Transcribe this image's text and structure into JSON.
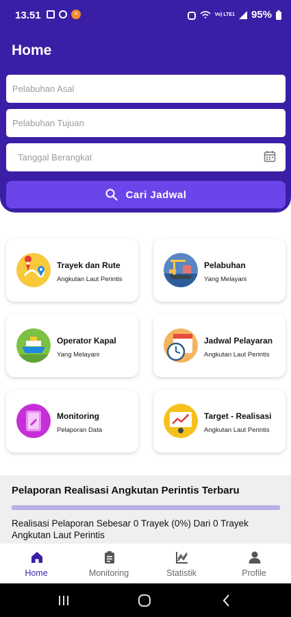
{
  "status_bar": {
    "time": "13.51",
    "battery": "95%",
    "signal": "Vo) LTE1"
  },
  "header": {
    "title": "Home",
    "origin_placeholder": "Pelabuhan Asal",
    "destination_placeholder": "Pelabuhan Tujuan",
    "date_placeholder": "Tanggal Berangkat",
    "search_label": "Cari Jadwal"
  },
  "menu": [
    {
      "title": "Trayek dan Rute",
      "subtitle": "Angkutan Laut Perintis",
      "icon": "route-map-icon"
    },
    {
      "title": "Pelabuhan",
      "subtitle": "Yang Melayani",
      "icon": "port-icon"
    },
    {
      "title": "Operator Kapal",
      "subtitle": "Yang Melayani",
      "icon": "ship-icon"
    },
    {
      "title": "Jadwal Pelayaran",
      "subtitle": "Angkutan Laut Perintis",
      "icon": "calendar-clock-icon"
    },
    {
      "title": "Monitoring",
      "subtitle": "Pelaporan Data",
      "icon": "clipboard-icon"
    },
    {
      "title": "Target - Realisasi",
      "subtitle": "Angkutan Laut Perintis",
      "icon": "chart-board-icon"
    }
  ],
  "report": {
    "title": "Pelaporan Realisasi Angkutan Perintis Terbaru",
    "progress_fraction": 0,
    "text": "Realisasi Pelaporan Sebesar 0 Trayek (0%) Dari 0 Trayek Angkutan Laut Perintis"
  },
  "bottom_nav": [
    {
      "label": "Home",
      "icon": "home-icon",
      "active": true
    },
    {
      "label": "Monitoring",
      "icon": "clipboard-icon",
      "active": false
    },
    {
      "label": "Statistik",
      "icon": "statistics-icon",
      "active": false
    },
    {
      "label": "Profile",
      "icon": "person-icon",
      "active": false
    }
  ],
  "colors": {
    "primary": "#3a1fa6",
    "button": "#6b45ea",
    "progress_track": "#b7b1e6"
  }
}
